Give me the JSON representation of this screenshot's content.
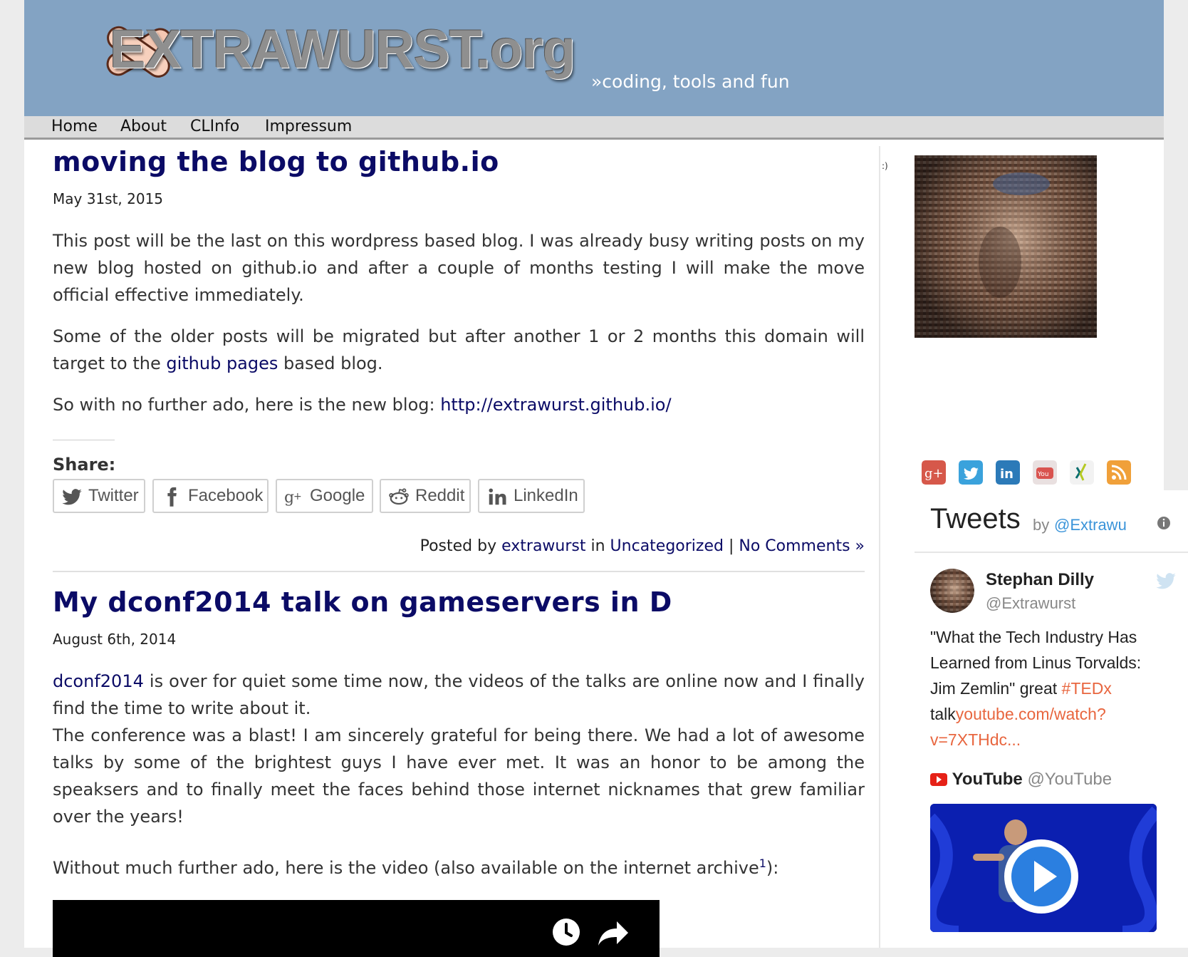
{
  "site": {
    "logo_text": "EXTRAWURST.org",
    "tagline": "»coding, tools and fun"
  },
  "nav": {
    "items": [
      "Home",
      "About",
      "CLInfo",
      "Impressum"
    ]
  },
  "posts": [
    {
      "title": "moving the blog to github.io",
      "date": "May 31st, 2015",
      "p1": "This post will be the last on this wordpress based blog. I was already busy writing posts on my new blog hosted on github.io and after a couple of months testing I will make the move official effective immediately.",
      "p2_before": "Some of the older posts will be migrated but after another 1 or 2 months this domain will target to the ",
      "p2_link": "github pages",
      "p2_after": " based blog.",
      "p3_before": "So with no further ado, here is the new blog: ",
      "p3_link": "http://extrawurst.github.io/",
      "share_label": "Share:",
      "share_buttons": [
        "Twitter",
        "Facebook",
        "Google",
        "Reddit",
        "LinkedIn"
      ],
      "posted_by_prefix": "Posted by ",
      "author": "extrawurst",
      "in_word": " in ",
      "category": "Uncategorized",
      "separator": " | ",
      "comments": "No Comments »"
    },
    {
      "title": "My dconf2014 talk on gameservers in D",
      "date": "August 6th, 2014",
      "p1_link": "dconf2014",
      "p1_after": " is over for quiet some time now, the videos of the talks are online now and I finally find the time to write about it.",
      "p2": "The conference was a blast! I am sincerely grateful for being there. We had a lot of awesome talks by some of the brightest guys I have ever met. It was an honor to be among the speaksers and to finally meet the faces behind those internet nicknames that grew familiar over the years!",
      "p3_before": "Without much further ado, here is the video (also available on the internet archive",
      "p3_sup": "1",
      "p3_after": "):"
    }
  ],
  "sidebar": {
    "smiley": ":)",
    "social_icons": [
      "google-plus-icon",
      "twitter-icon",
      "linkedin-icon",
      "youtube-icon",
      "xing-icon",
      "rss-icon"
    ],
    "tweets": {
      "heading": "Tweets",
      "by": "by",
      "handle": "@Extrawu",
      "tweet": {
        "name": "Stephan Dilly",
        "user": "@Extrawurst",
        "text_before": "\"What the Tech Industry Has Learned from Linus Torvalds: Jim Zemlin\" great ",
        "hashtag": "#TEDx",
        "text_mid": " talk",
        "link": "youtube.com/watch?v=7XTHdc..."
      },
      "yt_name": "YouTube",
      "yt_handle": "@YouTube"
    }
  },
  "colors": {
    "header_bg": "#83a3c3",
    "title_color": "#0b0b66",
    "twitter_blue": "#3b94d9",
    "tag_orange": "#e8663f"
  }
}
